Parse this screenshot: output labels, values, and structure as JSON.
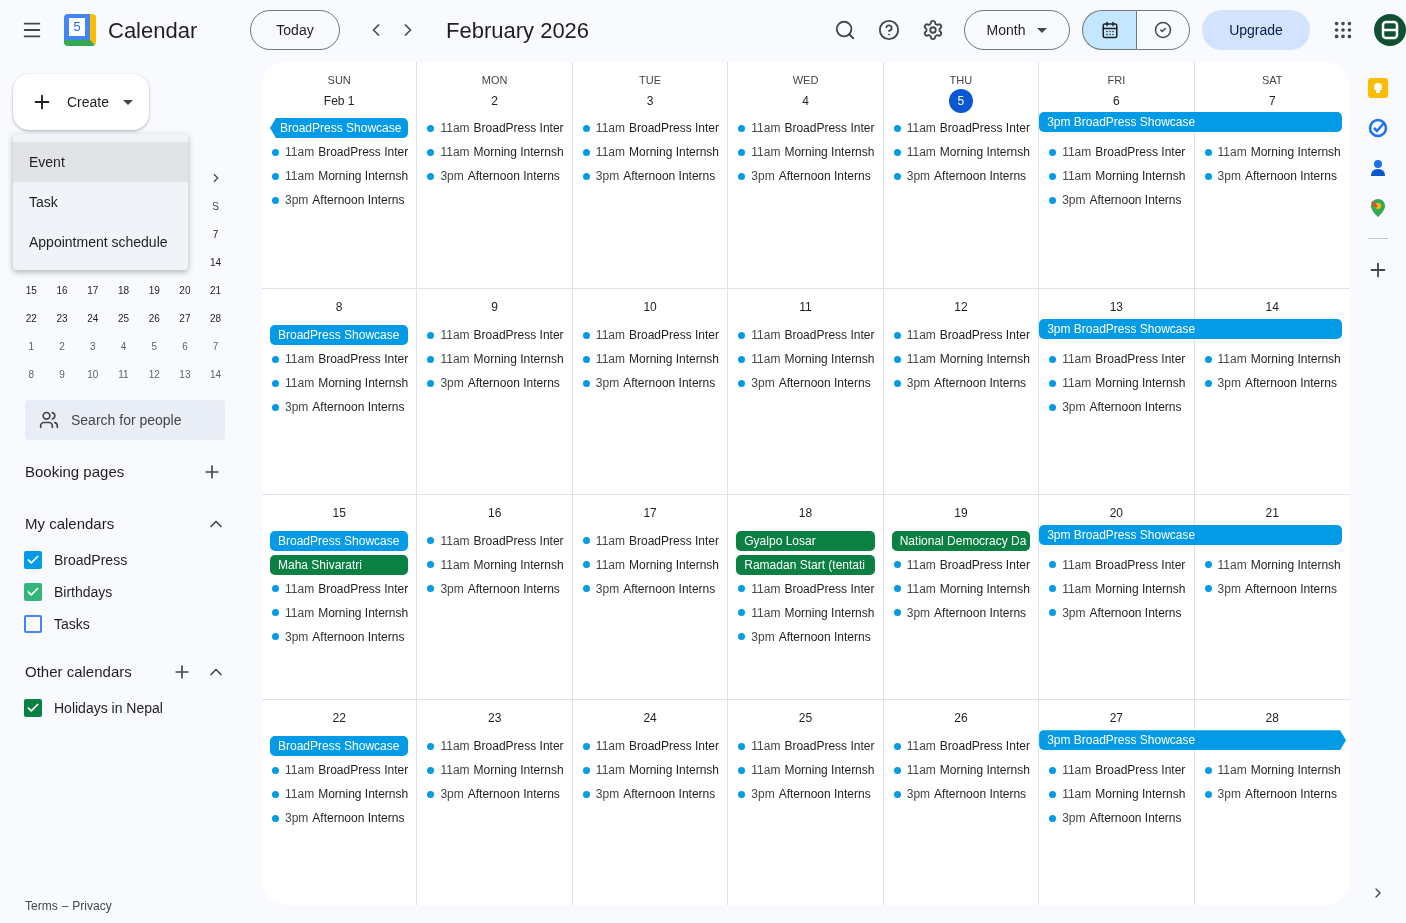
{
  "header": {
    "logo_date": "5",
    "app_name": "Calendar",
    "today_button": "Today",
    "period": "February 2026",
    "view_menu": "Month",
    "upgrade_button": "Upgrade"
  },
  "view_toggle": [
    {
      "kind": "calendar",
      "selected": true
    },
    {
      "kind": "tasks",
      "selected": false
    }
  ],
  "create_button": "Create",
  "create_menu": [
    {
      "label": "Event",
      "selected": true
    },
    {
      "label": "Task",
      "selected": false
    },
    {
      "label": "Appointment schedule",
      "selected": false
    }
  ],
  "mini_calendar": {
    "weekday": "S",
    "weeks": [
      {
        "days": [
          "7"
        ],
        "other_month": false
      },
      {
        "days": [
          "14"
        ],
        "other_month": false
      },
      {
        "days": [
          "15",
          "16",
          "17",
          "18",
          "19",
          "20",
          "21"
        ],
        "other_month": false
      },
      {
        "days": [
          "22",
          "23",
          "24",
          "25",
          "26",
          "27",
          "28"
        ],
        "other_month": false
      },
      {
        "days": [
          "1",
          "2",
          "3",
          "4",
          "5",
          "6",
          "7"
        ],
        "other_month": true
      },
      {
        "days": [
          "8",
          "9",
          "10",
          "11",
          "12",
          "13",
          "14"
        ],
        "other_month": true
      }
    ]
  },
  "people_search": {
    "placeholder": "Search for people"
  },
  "booking_pages": "Booking pages",
  "my_calendars": {
    "title": "My calendars",
    "expanded": true,
    "items": [
      {
        "label": "BroadPress",
        "checked": true,
        "color": "#039be5"
      },
      {
        "label": "Birthdays",
        "checked": true,
        "color": "#33b679"
      },
      {
        "label": "Tasks",
        "checked": false,
        "color": "#4285f4"
      }
    ]
  },
  "other_calendars": {
    "title": "Other calendars",
    "expanded": true,
    "items": [
      {
        "label": "Holidays in Nepal",
        "checked": true,
        "color": "#0b8043"
      }
    ]
  },
  "footer": {
    "terms": "Terms",
    "separator": "–",
    "privacy": "Privacy"
  },
  "weekdays": [
    "SUN",
    "MON",
    "TUE",
    "WED",
    "THU",
    "FRI",
    "SAT"
  ],
  "weeks": [
    {
      "days": [
        {
          "date": "Feb 1",
          "today": false,
          "covered": false,
          "events": [
            {
              "kind": "chip",
              "title": "BroadPress Showcase",
              "color": "#039be5",
              "continues_before": true
            },
            {
              "kind": "timed",
              "time": "11am",
              "title": "BroadPress Inter",
              "color": "#039be5"
            },
            {
              "kind": "timed",
              "time": "11am",
              "title": "Morning Internsh",
              "color": "#039be5"
            },
            {
              "kind": "timed",
              "time": "3pm",
              "title": "Afternoon Interns",
              "color": "#039be5"
            }
          ]
        },
        {
          "date": "2",
          "today": false,
          "covered": false,
          "events": [
            {
              "kind": "timed",
              "time": "11am",
              "title": "BroadPress Inter",
              "color": "#039be5"
            },
            {
              "kind": "timed",
              "time": "11am",
              "title": "Morning Internsh",
              "color": "#039be5"
            },
            {
              "kind": "timed",
              "time": "3pm",
              "title": "Afternoon Interns",
              "color": "#039be5"
            }
          ]
        },
        {
          "date": "3",
          "today": false,
          "covered": false,
          "events": [
            {
              "kind": "timed",
              "time": "11am",
              "title": "BroadPress Inter",
              "color": "#039be5"
            },
            {
              "kind": "timed",
              "time": "11am",
              "title": "Morning Internsh",
              "color": "#039be5"
            },
            {
              "kind": "timed",
              "time": "3pm",
              "title": "Afternoon Interns",
              "color": "#039be5"
            }
          ]
        },
        {
          "date": "4",
          "today": false,
          "covered": false,
          "events": [
            {
              "kind": "timed",
              "time": "11am",
              "title": "BroadPress Inter",
              "color": "#039be5"
            },
            {
              "kind": "timed",
              "time": "11am",
              "title": "Morning Internsh",
              "color": "#039be5"
            },
            {
              "kind": "timed",
              "time": "3pm",
              "title": "Afternoon Interns",
              "color": "#039be5"
            }
          ]
        },
        {
          "date": "5",
          "today": true,
          "covered": false,
          "events": [
            {
              "kind": "timed",
              "time": "11am",
              "title": "BroadPress Inter",
              "color": "#039be5"
            },
            {
              "kind": "timed",
              "time": "11am",
              "title": "Morning Internsh",
              "color": "#039be5"
            },
            {
              "kind": "timed",
              "time": "3pm",
              "title": "Afternoon Interns",
              "color": "#039be5"
            }
          ]
        },
        {
          "date": "6",
          "today": false,
          "covered": true,
          "multi_day": {
            "title": "3pm BroadPress Showcase",
            "color": "#039be5",
            "continues_after": false
          },
          "events": [
            {
              "kind": "timed",
              "time": "11am",
              "title": "BroadPress Inter",
              "color": "#039be5"
            },
            {
              "kind": "timed",
              "time": "11am",
              "title": "Morning Internsh",
              "color": "#039be5"
            },
            {
              "kind": "timed",
              "time": "3pm",
              "title": "Afternoon Interns",
              "color": "#039be5"
            }
          ]
        },
        {
          "date": "7",
          "today": false,
          "covered": true,
          "events": [
            {
              "kind": "timed",
              "time": "11am",
              "title": "Morning Internsh",
              "color": "#039be5"
            },
            {
              "kind": "timed",
              "time": "3pm",
              "title": "Afternoon Interns",
              "color": "#039be5"
            }
          ]
        }
      ]
    },
    {
      "days": [
        {
          "date": "8",
          "today": false,
          "covered": false,
          "events": [
            {
              "kind": "chip",
              "title": "BroadPress Showcase",
              "color": "#039be5",
              "continues_before": false
            },
            {
              "kind": "timed",
              "time": "11am",
              "title": "BroadPress Inter",
              "color": "#039be5"
            },
            {
              "kind": "timed",
              "time": "11am",
              "title": "Morning Internsh",
              "color": "#039be5"
            },
            {
              "kind": "timed",
              "time": "3pm",
              "title": "Afternoon Interns",
              "color": "#039be5"
            }
          ]
        },
        {
          "date": "9",
          "today": false,
          "covered": false,
          "events": [
            {
              "kind": "timed",
              "time": "11am",
              "title": "BroadPress Inter",
              "color": "#039be5"
            },
            {
              "kind": "timed",
              "time": "11am",
              "title": "Morning Internsh",
              "color": "#039be5"
            },
            {
              "kind": "timed",
              "time": "3pm",
              "title": "Afternoon Interns",
              "color": "#039be5"
            }
          ]
        },
        {
          "date": "10",
          "today": false,
          "covered": false,
          "events": [
            {
              "kind": "timed",
              "time": "11am",
              "title": "BroadPress Inter",
              "color": "#039be5"
            },
            {
              "kind": "timed",
              "time": "11am",
              "title": "Morning Internsh",
              "color": "#039be5"
            },
            {
              "kind": "timed",
              "time": "3pm",
              "title": "Afternoon Interns",
              "color": "#039be5"
            }
          ]
        },
        {
          "date": "11",
          "today": false,
          "covered": false,
          "events": [
            {
              "kind": "timed",
              "time": "11am",
              "title": "BroadPress Inter",
              "color": "#039be5"
            },
            {
              "kind": "timed",
              "time": "11am",
              "title": "Morning Internsh",
              "color": "#039be5"
            },
            {
              "kind": "timed",
              "time": "3pm",
              "title": "Afternoon Interns",
              "color": "#039be5"
            }
          ]
        },
        {
          "date": "12",
          "today": false,
          "covered": false,
          "events": [
            {
              "kind": "timed",
              "time": "11am",
              "title": "BroadPress Inter",
              "color": "#039be5"
            },
            {
              "kind": "timed",
              "time": "11am",
              "title": "Morning Internsh",
              "color": "#039be5"
            },
            {
              "kind": "timed",
              "time": "3pm",
              "title": "Afternoon Interns",
              "color": "#039be5"
            }
          ]
        },
        {
          "date": "13",
          "today": false,
          "covered": true,
          "multi_day": {
            "title": "3pm BroadPress Showcase",
            "color": "#039be5",
            "continues_after": false
          },
          "events": [
            {
              "kind": "timed",
              "time": "11am",
              "title": "BroadPress Inter",
              "color": "#039be5"
            },
            {
              "kind": "timed",
              "time": "11am",
              "title": "Morning Internsh",
              "color": "#039be5"
            },
            {
              "kind": "timed",
              "time": "3pm",
              "title": "Afternoon Interns",
              "color": "#039be5"
            }
          ]
        },
        {
          "date": "14",
          "today": false,
          "covered": true,
          "events": [
            {
              "kind": "timed",
              "time": "11am",
              "title": "Morning Internsh",
              "color": "#039be5"
            },
            {
              "kind": "timed",
              "time": "3pm",
              "title": "Afternoon Interns",
              "color": "#039be5"
            }
          ]
        }
      ]
    },
    {
      "days": [
        {
          "date": "15",
          "today": false,
          "covered": false,
          "events": [
            {
              "kind": "chip",
              "title": "BroadPress Showcase",
              "color": "#039be5",
              "continues_before": false
            },
            {
              "kind": "chip",
              "title": "Maha Shivaratri",
              "color": "#0b8043",
              "continues_before": false
            },
            {
              "kind": "timed",
              "time": "11am",
              "title": "BroadPress Inter",
              "color": "#039be5"
            },
            {
              "kind": "timed",
              "time": "11am",
              "title": "Morning Internsh",
              "color": "#039be5"
            },
            {
              "kind": "timed",
              "time": "3pm",
              "title": "Afternoon Interns",
              "color": "#039be5"
            }
          ]
        },
        {
          "date": "16",
          "today": false,
          "covered": false,
          "events": [
            {
              "kind": "timed",
              "time": "11am",
              "title": "BroadPress Inter",
              "color": "#039be5"
            },
            {
              "kind": "timed",
              "time": "11am",
              "title": "Morning Internsh",
              "color": "#039be5"
            },
            {
              "kind": "timed",
              "time": "3pm",
              "title": "Afternoon Interns",
              "color": "#039be5"
            }
          ]
        },
        {
          "date": "17",
          "today": false,
          "covered": false,
          "events": [
            {
              "kind": "timed",
              "time": "11am",
              "title": "BroadPress Inter",
              "color": "#039be5"
            },
            {
              "kind": "timed",
              "time": "11am",
              "title": "Morning Internsh",
              "color": "#039be5"
            },
            {
              "kind": "timed",
              "time": "3pm",
              "title": "Afternoon Interns",
              "color": "#039be5"
            }
          ]
        },
        {
          "date": "18",
          "today": false,
          "covered": false,
          "events": [
            {
              "kind": "chip",
              "title": "Gyalpo Losar",
              "color": "#0b8043",
              "continues_before": false
            },
            {
              "kind": "chip",
              "title": "Ramadan Start (tentati",
              "color": "#0b8043",
              "continues_before": false
            },
            {
              "kind": "timed",
              "time": "11am",
              "title": "BroadPress Inter",
              "color": "#039be5"
            },
            {
              "kind": "timed",
              "time": "11am",
              "title": "Morning Internsh",
              "color": "#039be5"
            },
            {
              "kind": "timed",
              "time": "3pm",
              "title": "Afternoon Interns",
              "color": "#039be5"
            }
          ]
        },
        {
          "date": "19",
          "today": false,
          "covered": false,
          "events": [
            {
              "kind": "chip",
              "title": "National Democracy Da",
              "color": "#0b8043",
              "continues_before": false
            },
            {
              "kind": "timed",
              "time": "11am",
              "title": "BroadPress Inter",
              "color": "#039be5"
            },
            {
              "kind": "timed",
              "time": "11am",
              "title": "Morning Internsh",
              "color": "#039be5"
            },
            {
              "kind": "timed",
              "time": "3pm",
              "title": "Afternoon Interns",
              "color": "#039be5"
            }
          ]
        },
        {
          "date": "20",
          "today": false,
          "covered": true,
          "multi_day": {
            "title": "3pm BroadPress Showcase",
            "color": "#039be5",
            "continues_after": false
          },
          "events": [
            {
              "kind": "timed",
              "time": "11am",
              "title": "BroadPress Inter",
              "color": "#039be5"
            },
            {
              "kind": "timed",
              "time": "11am",
              "title": "Morning Internsh",
              "color": "#039be5"
            },
            {
              "kind": "timed",
              "time": "3pm",
              "title": "Afternoon Interns",
              "color": "#039be5"
            }
          ]
        },
        {
          "date": "21",
          "today": false,
          "covered": true,
          "events": [
            {
              "kind": "timed",
              "time": "11am",
              "title": "Morning Internsh",
              "color": "#039be5"
            },
            {
              "kind": "timed",
              "time": "3pm",
              "title": "Afternoon Interns",
              "color": "#039be5"
            }
          ]
        }
      ]
    },
    {
      "days": [
        {
          "date": "22",
          "today": false,
          "covered": false,
          "events": [
            {
              "kind": "chip",
              "title": "BroadPress Showcase",
              "color": "#039be5",
              "continues_before": false
            },
            {
              "kind": "timed",
              "time": "11am",
              "title": "BroadPress Inter",
              "color": "#039be5"
            },
            {
              "kind": "timed",
              "time": "11am",
              "title": "Morning Internsh",
              "color": "#039be5"
            },
            {
              "kind": "timed",
              "time": "3pm",
              "title": "Afternoon Interns",
              "color": "#039be5"
            }
          ]
        },
        {
          "date": "23",
          "today": false,
          "covered": false,
          "events": [
            {
              "kind": "timed",
              "time": "11am",
              "title": "BroadPress Inter",
              "color": "#039be5"
            },
            {
              "kind": "timed",
              "time": "11am",
              "title": "Morning Internsh",
              "color": "#039be5"
            },
            {
              "kind": "timed",
              "time": "3pm",
              "title": "Afternoon Interns",
              "color": "#039be5"
            }
          ]
        },
        {
          "date": "24",
          "today": false,
          "covered": false,
          "events": [
            {
              "kind": "timed",
              "time": "11am",
              "title": "BroadPress Inter",
              "color": "#039be5"
            },
            {
              "kind": "timed",
              "time": "11am",
              "title": "Morning Internsh",
              "color": "#039be5"
            },
            {
              "kind": "timed",
              "time": "3pm",
              "title": "Afternoon Interns",
              "color": "#039be5"
            }
          ]
        },
        {
          "date": "25",
          "today": false,
          "covered": false,
          "events": [
            {
              "kind": "timed",
              "time": "11am",
              "title": "BroadPress Inter",
              "color": "#039be5"
            },
            {
              "kind": "timed",
              "time": "11am",
              "title": "Morning Internsh",
              "color": "#039be5"
            },
            {
              "kind": "timed",
              "time": "3pm",
              "title": "Afternoon Interns",
              "color": "#039be5"
            }
          ]
        },
        {
          "date": "26",
          "today": false,
          "covered": false,
          "events": [
            {
              "kind": "timed",
              "time": "11am",
              "title": "BroadPress Inter",
              "color": "#039be5"
            },
            {
              "kind": "timed",
              "time": "11am",
              "title": "Morning Internsh",
              "color": "#039be5"
            },
            {
              "kind": "timed",
              "time": "3pm",
              "title": "Afternoon Interns",
              "color": "#039be5"
            }
          ]
        },
        {
          "date": "27",
          "today": false,
          "covered": true,
          "multi_day": {
            "title": "3pm BroadPress Showcase",
            "color": "#039be5",
            "continues_after": true
          },
          "events": [
            {
              "kind": "timed",
              "time": "11am",
              "title": "BroadPress Inter",
              "color": "#039be5"
            },
            {
              "kind": "timed",
              "time": "11am",
              "title": "Morning Internsh",
              "color": "#039be5"
            },
            {
              "kind": "timed",
              "time": "3pm",
              "title": "Afternoon Interns",
              "color": "#039be5"
            }
          ]
        },
        {
          "date": "28",
          "today": false,
          "covered": true,
          "events": [
            {
              "kind": "timed",
              "time": "11am",
              "title": "Morning Internsh",
              "color": "#039be5"
            },
            {
              "kind": "timed",
              "time": "3pm",
              "title": "Afternoon Interns",
              "color": "#039be5"
            }
          ]
        }
      ]
    }
  ]
}
